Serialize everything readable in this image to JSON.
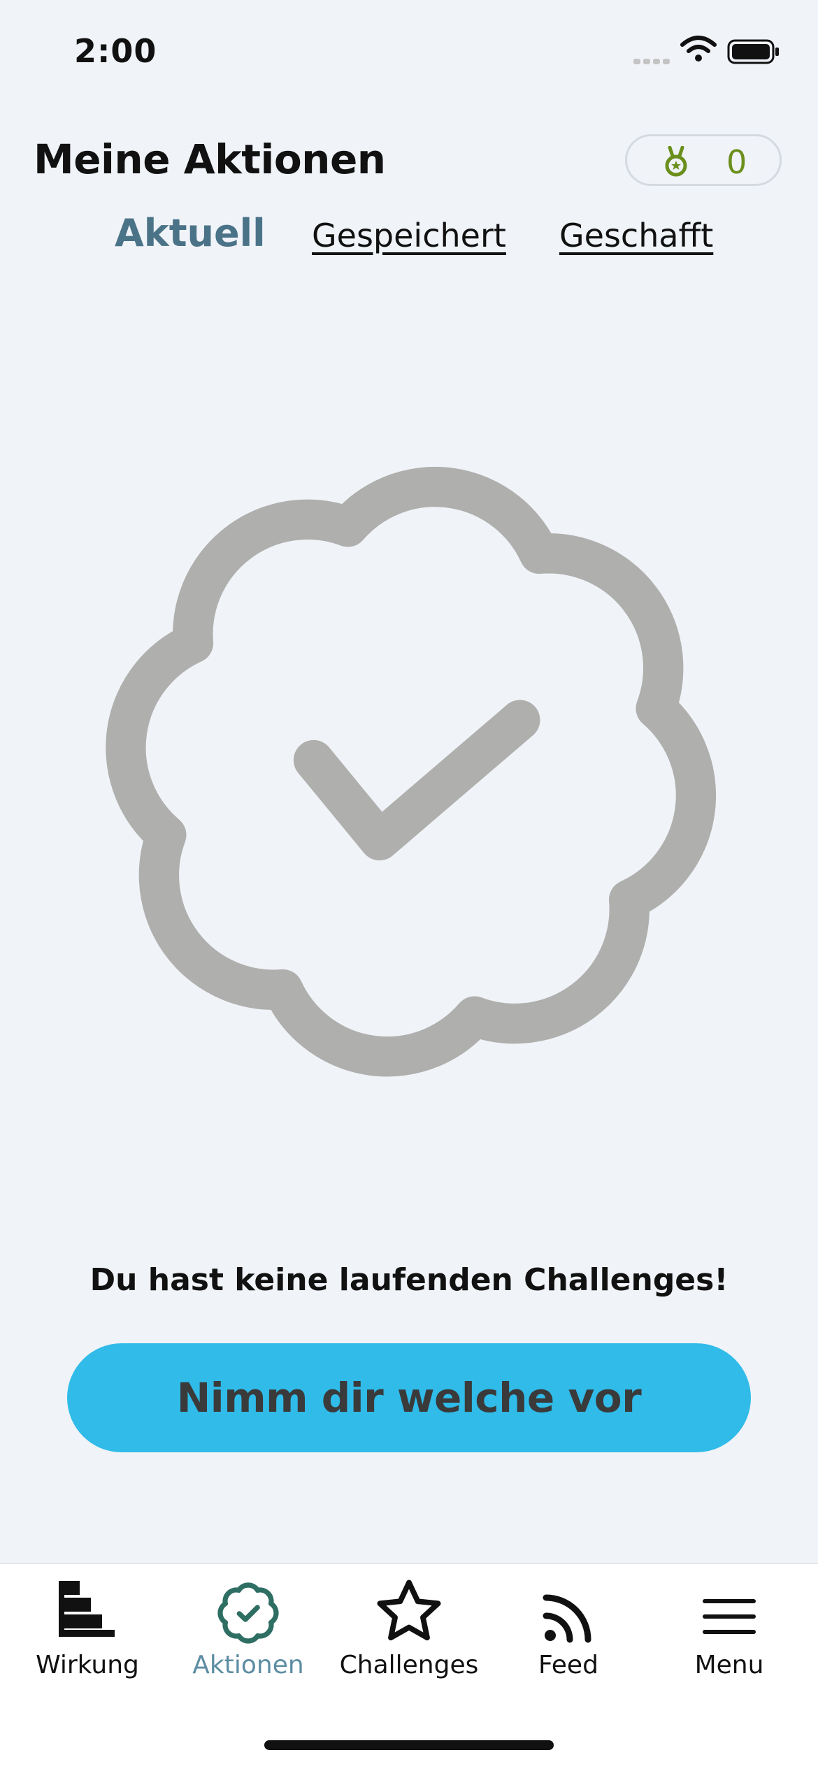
{
  "status_bar": {
    "time": "2:00"
  },
  "header": {
    "title": "Meine Aktionen",
    "points": "0",
    "points_icon": "medal-icon"
  },
  "tabs": [
    {
      "label": "Aktuell",
      "active": true
    },
    {
      "label": "Gespeichert",
      "active": false
    },
    {
      "label": "Geschafft",
      "active": false
    }
  ],
  "empty_state": {
    "icon": "badge-check-icon",
    "message": "Du hast keine laufenden Challenges!",
    "cta_label": "Nimm dir welche vor"
  },
  "bottom_nav": [
    {
      "label": "Wirkung",
      "icon": "impact-chart-icon",
      "active": false
    },
    {
      "label": "Aktionen",
      "icon": "badge-check-icon",
      "active": true
    },
    {
      "label": "Challenges",
      "icon": "star-icon",
      "active": false
    },
    {
      "label": "Feed",
      "icon": "rss-feed-icon",
      "active": false
    },
    {
      "label": "Menu",
      "icon": "hamburger-menu-icon",
      "active": false
    }
  ],
  "colors": {
    "background": "#f0f3f8",
    "accent": "#4a7388",
    "cta": "#30bbe9",
    "nav_active": "#5c8da3",
    "points": "#6b8f1c",
    "illustration": "#afafad"
  }
}
